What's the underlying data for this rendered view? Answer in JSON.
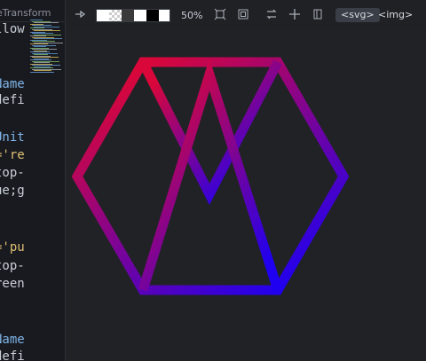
{
  "editor": {
    "tab_title": "nateTransform",
    "code_lines": [
      {
        "text": "llow",
        "color": "#c9ced6"
      },
      {
        "text": "Name",
        "color": "#7fb4e8"
      },
      {
        "text": "defi",
        "color": "#c9ced6"
      },
      {
        "text": "Unit",
        "color": "#7fb4e8"
      },
      {
        "text": "='re",
        "color": "#e0c074"
      },
      {
        "text": "top-",
        "color": "#c9ced6"
      },
      {
        "text": "ue;g",
        "color": "#c9ced6"
      },
      {
        "text": "='pu",
        "color": "#e0c074"
      },
      {
        "text": "top-",
        "color": "#c9ced6"
      },
      {
        "text": "reen",
        "color": "#c9ced6"
      },
      {
        "text": "Name",
        "color": "#7fb4e8"
      },
      {
        "text": "defi",
        "color": "#c9ced6"
      }
    ]
  },
  "toolbar": {
    "pin_icon": "pin-icon",
    "zoom_label": "50%",
    "fit_icon": "fit-icon",
    "actual_size_icon": "actual-size-icon",
    "swap_icon": "swap-icon",
    "add_icon": "plus-icon",
    "panel_icon": "panel-icon",
    "svg_tab": "<svg>",
    "img_tab": "<img>",
    "background_swatches": [
      "#ffffff",
      "checker",
      "#3a3a3a",
      "#ffffff",
      "#000000",
      "#ffffff"
    ]
  },
  "canvas": {
    "gradient_start": "#d9073a",
    "gradient_end": "#1f00f0",
    "background": "#202226"
  }
}
